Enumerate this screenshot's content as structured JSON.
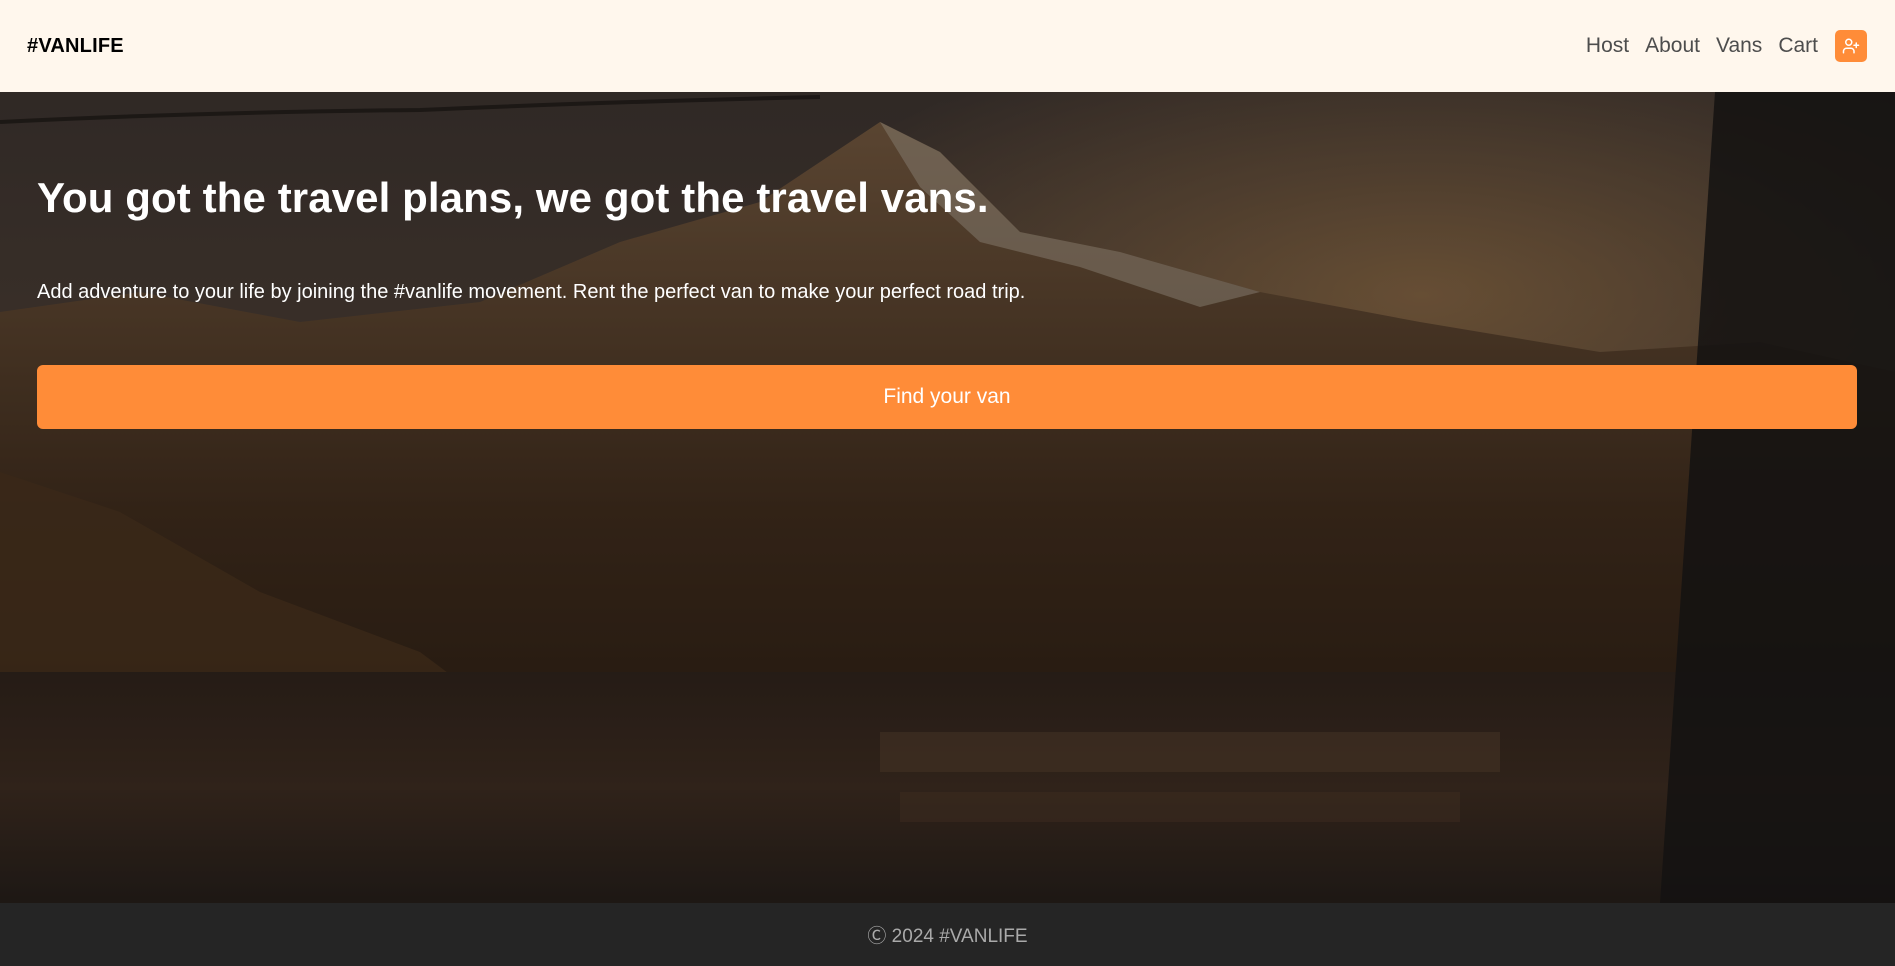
{
  "header": {
    "logo": "#VANLIFE",
    "nav": [
      {
        "label": "Host"
      },
      {
        "label": "About"
      },
      {
        "label": "Vans"
      },
      {
        "label": "Cart"
      }
    ],
    "user_button_icon": "user-plus-icon"
  },
  "hero": {
    "title": "You got the travel plans, we got the travel vans.",
    "subtitle": "Add adventure to your life by joining the #vanlife movement. Rent the perfect van to make your perfect road trip.",
    "cta_label": "Find your van"
  },
  "footer": {
    "text": "Ⓒ 2024 #VANLIFE"
  },
  "colors": {
    "accent": "#FF8C38",
    "header_bg": "#FFF7ED",
    "footer_bg": "#252525"
  }
}
